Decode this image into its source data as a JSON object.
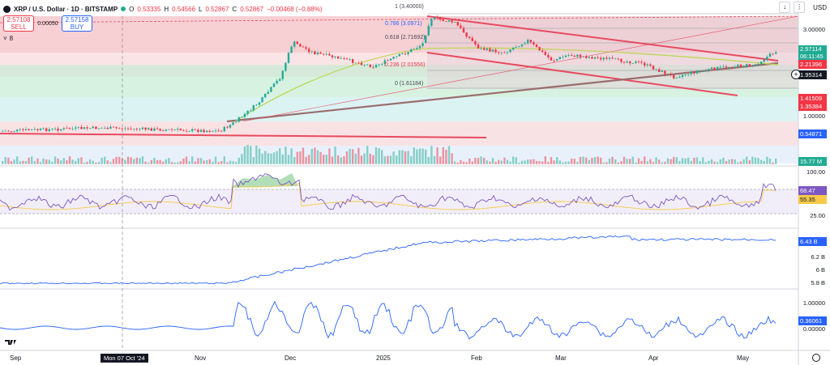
{
  "header": {
    "symbol": "XRP / U.S. Dollar · 1D · BITSTAMP",
    "o_label": "O",
    "o_value": "0.53335",
    "h_label": "H",
    "h_value": "0.54566",
    "l_label": "L",
    "l_value": "0.52867",
    "c_label": "C",
    "c_value": "0.52867",
    "change": "−0.00468 (−0.88%)"
  },
  "trade": {
    "sell_price": "2.57108",
    "sell_label": "SELL",
    "spread": "0.00050",
    "buy_price": "2.57158",
    "buy_label": "BUY"
  },
  "indicators": {
    "count": "8"
  },
  "topbar": {
    "currency": "USD"
  },
  "price_axis": {
    "labels": [
      "3.00000",
      "1.00000",
      "0.54871"
    ],
    "current_price": "2.57114",
    "countdown": "06:11:45",
    "badges": [
      "2.21396",
      "1.95314",
      "1.41509",
      "1.35384"
    ],
    "volume": "15.77 M"
  },
  "fib_levels": [
    "1 (3.40000)",
    "0.786 (3.0971)",
    "0.618 (2.71692)",
    "0.236 (2.01556)",
    "0 (1.61184)"
  ],
  "rsi_axis": {
    "top": "100.00",
    "value": "68.47",
    "ma": "55.35",
    "bottom": "25.00"
  },
  "pane3_axis": {
    "value": "6.43 B",
    "l1": "6.2 B",
    "l2": "6 B",
    "l3": "5.8 B"
  },
  "pane4_axis": {
    "top": "1.00000",
    "value": "0.36061",
    "bottom": "0.00000"
  },
  "time_axis": {
    "labels": [
      "Sep",
      "Nov",
      "Dec",
      "2025",
      "Feb",
      "Mar",
      "Apr",
      "May"
    ],
    "crosshair": "Mon 07 Oct '24"
  },
  "colors": {
    "up": "#22ab94",
    "down": "#f23645",
    "rsi": "#7e57c2",
    "ma": "#f7c948",
    "line": "#2962ff",
    "trend": "#e84a5f"
  }
}
